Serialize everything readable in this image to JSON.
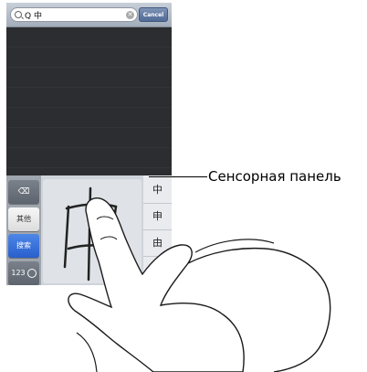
{
  "search": {
    "query": "Q 中",
    "clear_glyph": "✕",
    "cancel_label": "Cancel"
  },
  "keyboard": {
    "delete_glyph": "⌫",
    "other_label": "其他",
    "search_label": "搜索",
    "numbers_label": "123",
    "candidates": [
      "中",
      "申",
      "由"
    ]
  },
  "callout": {
    "label": "Сенсорная панель"
  },
  "icons": {
    "search": "magnifier-icon",
    "clear": "clear-icon",
    "delete": "delete-icon",
    "globe": "globe-icon"
  }
}
